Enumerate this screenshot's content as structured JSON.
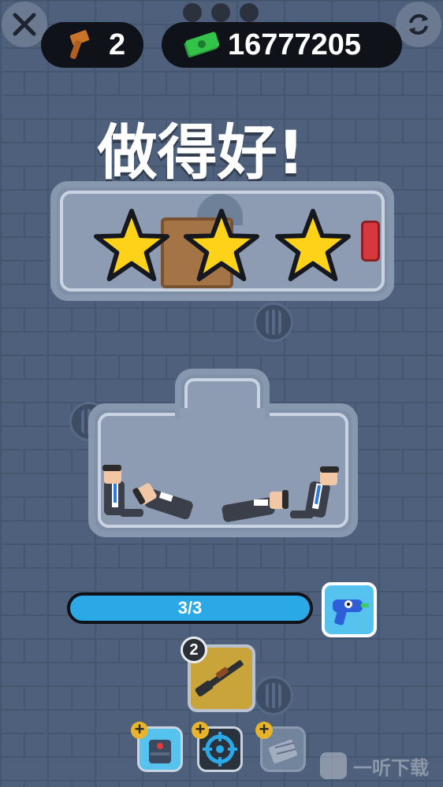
{
  "hud": {
    "hammers": "2",
    "cash": "16777205"
  },
  "title": "做得好!",
  "stars_earned": 3,
  "stars_total": 3,
  "kills": {
    "label": "3/3",
    "progress": 1.0
  },
  "weapon": {
    "count": "2",
    "icon": "shotgun-icon"
  },
  "powerups": [
    {
      "icon": "bomb-vest-icon",
      "badge": "+"
    },
    {
      "icon": "crosshair-icon",
      "badge": "+"
    },
    {
      "icon": "cage-icon",
      "badge": "+"
    }
  ],
  "colors": {
    "progress": "#2aa9e6",
    "star": "#ffd21a",
    "weapon_tile": "#c9a43a",
    "cash_icon": "#33c24a"
  },
  "watermark": "一听下载"
}
